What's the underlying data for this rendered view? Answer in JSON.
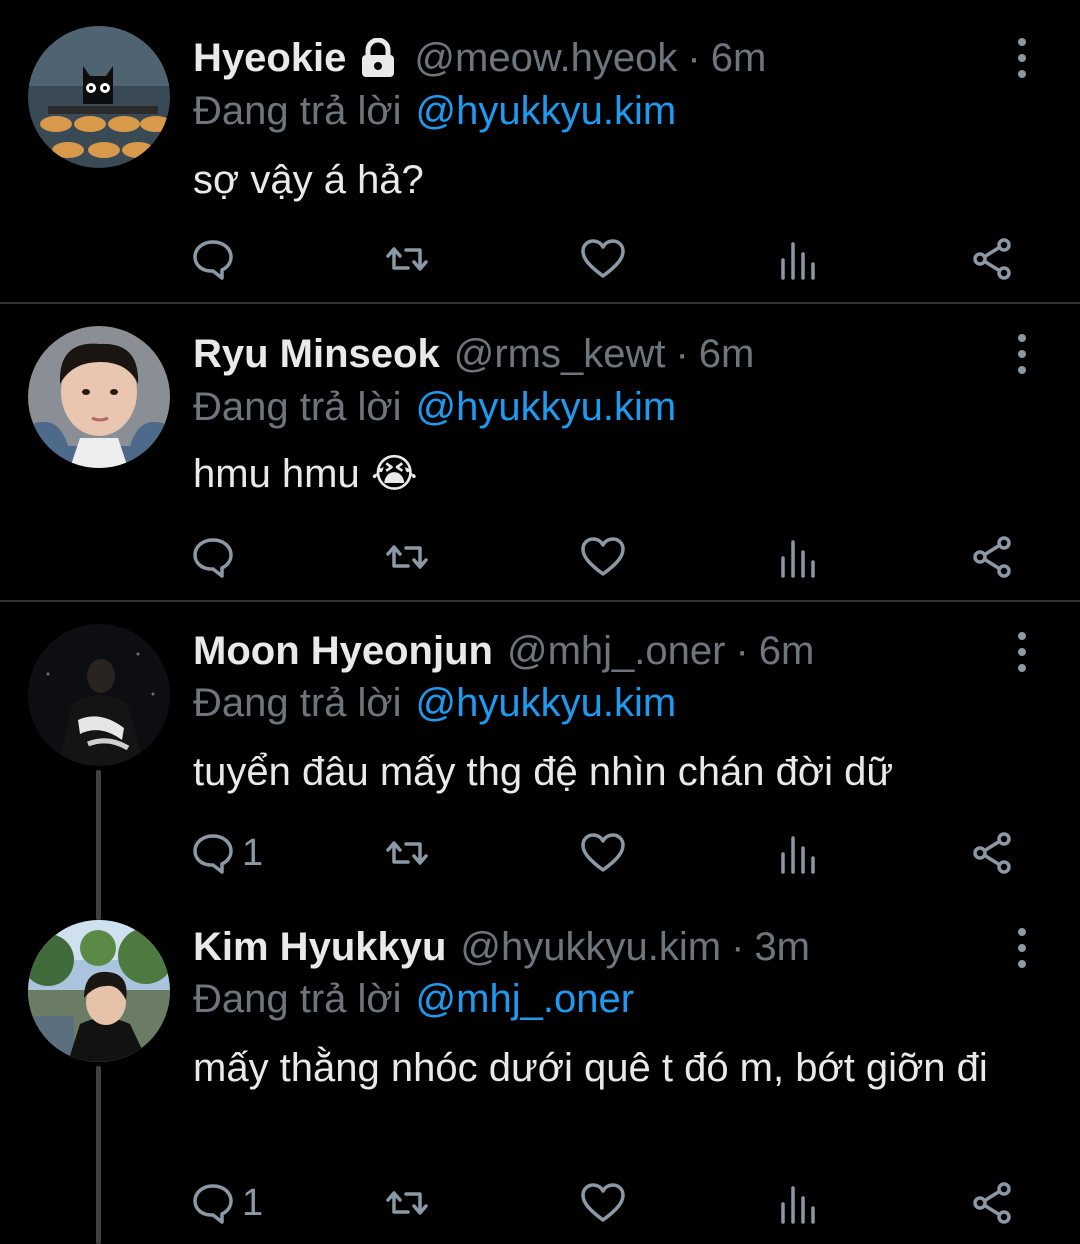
{
  "tweets": [
    {
      "name": "Hyeokie",
      "locked": true,
      "handle": "@meow.hyeok",
      "separator": "·",
      "time": "6m",
      "reply_prefix": "Đang trả lời",
      "reply_to": "@hyukkyu.kim",
      "text": "sợ vậy á hả?",
      "reply_count": ""
    },
    {
      "name": "Ryu Minseok",
      "locked": false,
      "handle": "@rms_kewt",
      "separator": "·",
      "time": "6m",
      "reply_prefix": "Đang trả lời",
      "reply_to": "@hyukkyu.kim",
      "text": "hmu hmu 😭",
      "reply_count": ""
    },
    {
      "name": "Moon Hyeonjun",
      "locked": false,
      "handle": "@mhj_.oner",
      "separator": "·",
      "time": "6m",
      "reply_prefix": "Đang trả lời",
      "reply_to": "@hyukkyu.kim",
      "text": "tuyển đâu mấy thg đệ nhìn chán đời dữ",
      "reply_count": "1"
    },
    {
      "name": "Kim Hyukkyu",
      "locked": false,
      "handle": "@hyukkyu.kim",
      "separator": "·",
      "time": "3m",
      "reply_prefix": "Đang trả lời",
      "reply_to": "@mhj_.oner",
      "text": "mấy thằng nhóc dưới quê t đó m, bớt giỡn đi",
      "reply_count": "1"
    }
  ],
  "icons": {
    "reply": "reply-icon",
    "retweet": "retweet-icon",
    "like": "heart-icon",
    "views": "views-icon",
    "share": "share-icon",
    "more": "more-icon",
    "lock": "lock-icon"
  },
  "colors": {
    "background": "#000000",
    "text": "#e7e9ea",
    "muted": "#6e767d",
    "link": "#1d9bf0",
    "divider": "#2f3336"
  }
}
